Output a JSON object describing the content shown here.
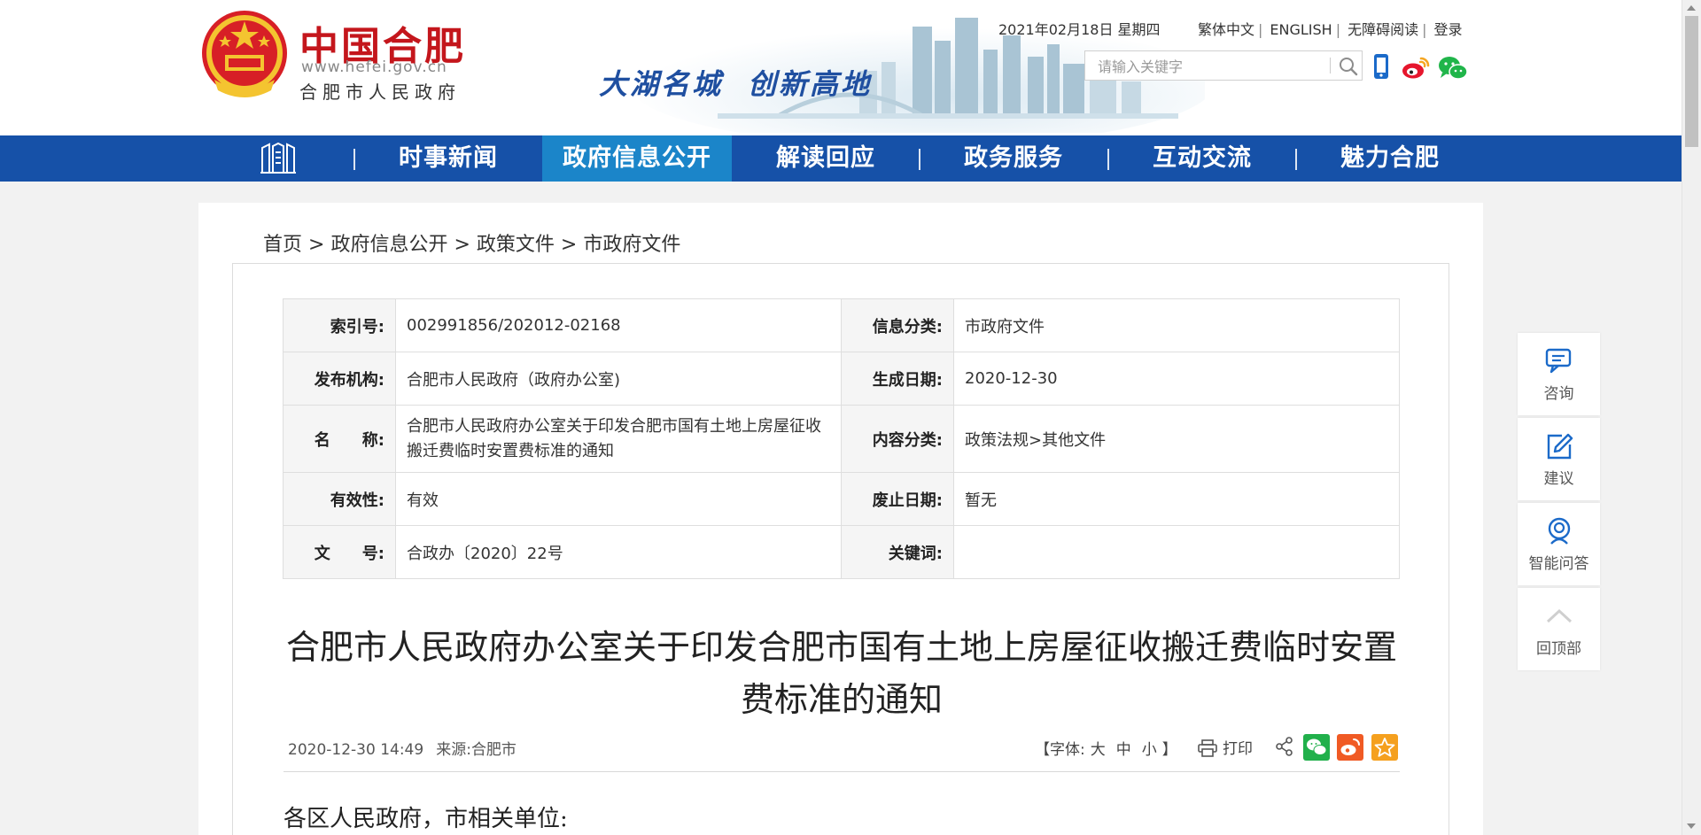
{
  "header": {
    "logo_cn": "中国合肥",
    "logo_url": "www.hefei.gov.cn",
    "logo_sub": "合肥市人民政府",
    "slogan_1": "大湖名城",
    "slogan_2": "创新高地",
    "date": "2021年02月18日 星期四",
    "links": [
      "繁体中文",
      "ENGLISH",
      "无障碍阅读",
      "登录"
    ],
    "search_placeholder": "请输入关键字",
    "icons": [
      "search-icon",
      "mobile-icon",
      "weibo-icon",
      "wechat-icon"
    ]
  },
  "nav": {
    "items": [
      "时事新闻",
      "政府信息公开",
      "解读回应",
      "政务服务",
      "互动交流",
      "魅力合肥"
    ],
    "active_index": 1,
    "colors": {
      "bar": "#1651a8",
      "active": "#1b85c9"
    }
  },
  "breadcrumb": {
    "items": [
      "首页",
      "政府信息公开",
      "政策文件",
      "市政府文件"
    ],
    "separator": ">"
  },
  "meta": {
    "rows": [
      {
        "k1": "索引号:",
        "v1": "002991856/202012-02168",
        "k2": "信息分类:",
        "v2": "市政府文件"
      },
      {
        "k1": "发布机构:",
        "v1": "合肥市人民政府（政府办公室)",
        "k2": "生成日期:",
        "v2": "2020-12-30"
      },
      {
        "k1": "名　　称:",
        "v1": "合肥市人民政府办公室关于印发合肥市国有土地上房屋征收搬迁费临时安置费标准的通知",
        "k2": "内容分类:",
        "v2": "政策法规>其他文件"
      },
      {
        "k1": "有效性:",
        "v1": "有效",
        "k2": "废止日期:",
        "v2": "暂无"
      },
      {
        "k1": "文　　号:",
        "v1": "合政办〔2020〕22号",
        "k2": "关键词:",
        "v2": ""
      }
    ]
  },
  "article": {
    "title": "合肥市人民政府办公室关于印发合肥市国有土地上房屋征收搬迁费临时安置费标准的通知",
    "datetime": "2020-12-30 14:49",
    "source_label": "来源:",
    "source": "合肥市",
    "font_label": "【字体:",
    "font_sizes": [
      "大",
      "中",
      "小"
    ],
    "font_close": "】",
    "print_label": "打印",
    "greeting": "各区人民政府，市相关单位:"
  },
  "sidebar": {
    "items": [
      "咨询",
      "建议",
      "智能问答",
      "回顶部"
    ]
  }
}
